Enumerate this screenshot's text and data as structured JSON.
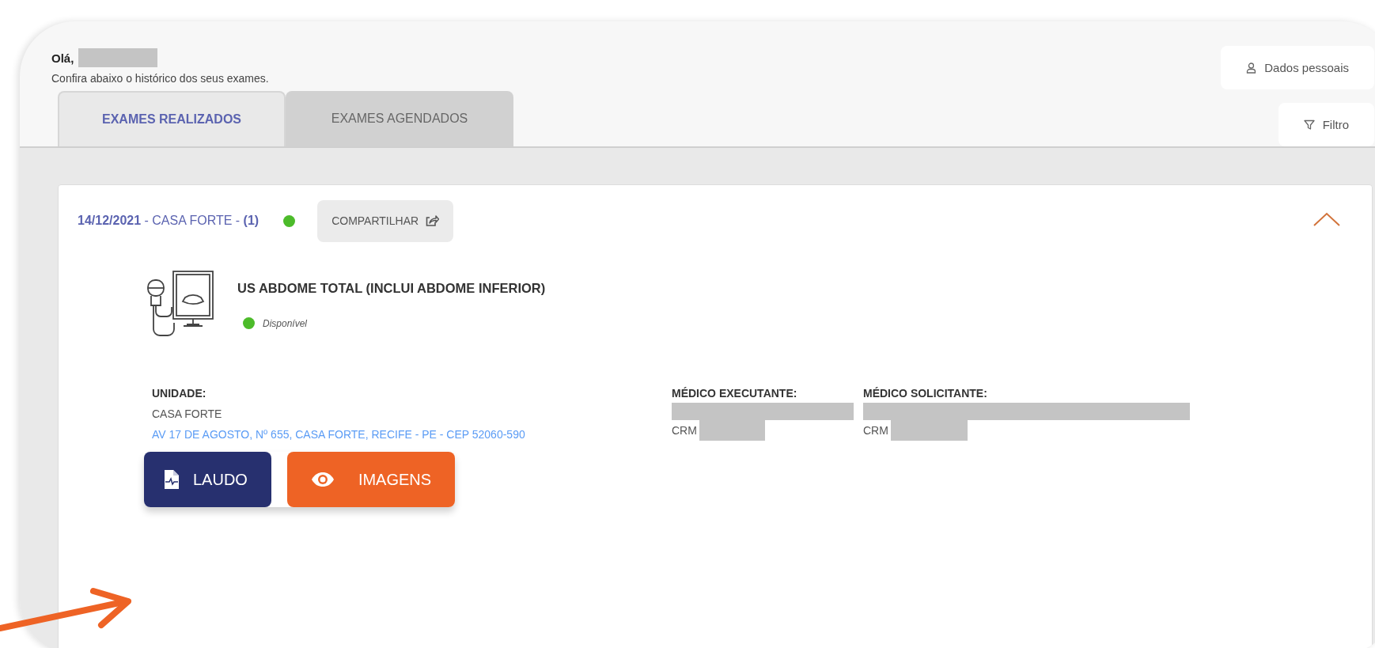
{
  "header": {
    "greeting": "Olá,",
    "subtitle": "Confira abaixo o histórico dos seus exames."
  },
  "actions": [
    {
      "label": "Dados pessoais",
      "kind": "user"
    },
    {
      "label": "Filtro",
      "kind": "filter"
    }
  ],
  "tabs": [
    {
      "label": "EXAMES REALIZADOS",
      "selected": true
    },
    {
      "label": "EXAMES AGENDADOS",
      "selected": false
    }
  ],
  "visit": {
    "title": "**14/12/2021** - CASA FORTE - **(1)**",
    "available": true,
    "share_button": "COMPARTILHAR",
    "expanded": true,
    "exam": {
      "name": "US ABDOME TOTAL (INCLUI ABDOME INFERIOR)",
      "status": "Disponível",
      "available": true
    },
    "details": [
      {
        "label": "UNIDADE:",
        "lines": [
          {
            "kind": "text",
            "text": "CASA FORTE"
          },
          {
            "kind": "link",
            "text": "AV 17 DE AGOSTO, Nº 655, CASA FORTE, RECIFE - PE - CEP 52060-590"
          }
        ]
      },
      {
        "label": "MÉDICO EXECUTANTE:",
        "lines": [
          {
            "kind": "redacted"
          },
          {
            "kind": "crm",
            "text": "CRM"
          }
        ]
      },
      {
        "label": "MÉDICO SOLICITANTE:",
        "lines": [
          {
            "kind": "redacted"
          },
          {
            "kind": "crm",
            "text": "CRM"
          }
        ]
      }
    ],
    "buttons": [
      {
        "label": "LAUDO",
        "kind": "report"
      },
      {
        "label": "IMAGENS",
        "kind": "images"
      }
    ]
  }
}
